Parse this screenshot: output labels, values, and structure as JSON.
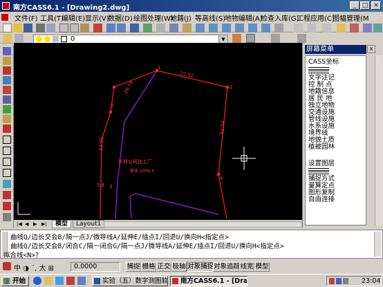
{
  "window": {
    "title": "南方CASS6.1 - [Drawing2.dwg]"
  },
  "menu": [
    "文件(F)",
    "工具(T)",
    "编辑(E)",
    "显示(V)",
    "数据(D)",
    "绘图处理(W)",
    "地籍(J)",
    "等高线(S)",
    "地物编辑(A)",
    "检查入库(G)",
    "工程应用(C)",
    "图幅管理(M)"
  ],
  "toolbar": {
    "layer_value": "0"
  },
  "drawing": {
    "factory_label": "东林公司加工厂",
    "small_label": "营业 2306.4",
    "dims": [
      "22.52",
      "16.74",
      "23.95",
      "31.24",
      "5.8"
    ],
    "points": [
      "1",
      "2",
      "3",
      "4",
      "5"
    ]
  },
  "screen_menu": {
    "title": "屏幕菜单",
    "items": [
      "CASS坐标",
      "文字注记",
      "控 制 点",
      "地籍信息",
      "居 民 地",
      "独立地物",
      "交通设施",
      "管线设施",
      "水系设施",
      "境界线",
      "地貌土质",
      "植被园林"
    ],
    "items2": [
      "设置图层",
      "捕捉方式",
      "量算定点",
      "图形复制",
      "自由连接"
    ]
  },
  "tabs": {
    "model": "模型",
    "layout": "Layout1"
  },
  "command": {
    "line1": "曲线Q/边长交会B/隔一点J/微导线A/延伸E/插点I/回退U/换向H<指定点>",
    "line2": "曲线Q/边长交会B/闭合C/隔一闭合G/隔一点J/微导线A/延伸E/插点I/回退U/换向H<指定点>",
    "line3": "拟合线<N>?"
  },
  "status": {
    "coord": "0.0000",
    "buttons": [
      "捕捉",
      "栅格",
      "正交",
      "极轴",
      "对象捕捉",
      "对象追踪",
      "线宽",
      "模型"
    ]
  },
  "taskbar": {
    "start": "开始",
    "tasks": [
      "实验（五）数字测图软...",
      "南方CASS6.1 - [Drawing..."
    ],
    "time": "23:04"
  },
  "colors": {
    "accent": "#0a246a",
    "canvas": "#000000",
    "red_line": "#ff2020",
    "purple_line": "#a020f0"
  }
}
